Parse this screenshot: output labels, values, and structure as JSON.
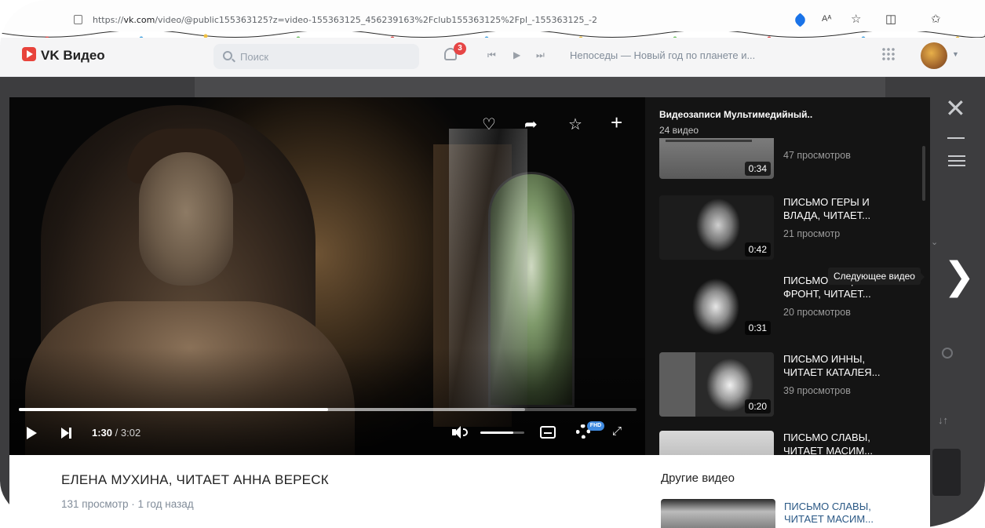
{
  "browser": {
    "url_prefix": "https://",
    "url_domain": "vk.com",
    "url_rest": "/video/@public155363125?z=video-155363125_456239163%2Fclub155363125%2Fpl_-155363125_-2",
    "read_aloud_icon_text": "Aᴬ"
  },
  "header": {
    "title": "VK Видео",
    "search_placeholder": "Поиск",
    "notification_count": "3",
    "now_playing": "Непоседы — Новый год по планете и..."
  },
  "player": {
    "time_current": "1:30",
    "time_total": " / 3:02",
    "progress": 0.5,
    "buffered": 0.82,
    "volume": 0.75,
    "quality_badge": "FHD"
  },
  "playlist": {
    "title": "Видеозаписи Мультимедийный..",
    "count": "24 видео",
    "items": [
      {
        "duration": "0:34",
        "title": "",
        "views": "47 просмотров"
      },
      {
        "duration": "0:42",
        "title": "ПИСЬМО ГЕРЫ И ВЛАДА, ЧИТАЕТ...",
        "views": "21 просмотр"
      },
      {
        "duration": "0:31",
        "title": "ПИСЬМО ОТЦА НА ФРОНТ, ЧИТАЕТ...",
        "views": "20 просмотров"
      },
      {
        "duration": "0:20",
        "title": "ПИСЬМО ИННЫ, ЧИТАЕТ КАТАЛЕЯ...",
        "views": "39 просмотров"
      },
      {
        "duration": "",
        "title": "ПИСЬМО СЛАВЫ, ЧИТАЕТ МАСИМ...",
        "views": ""
      }
    ]
  },
  "tooltip": {
    "next_video": "Следующее видео"
  },
  "video": {
    "title": "ЕЛЕНА МУХИНА, ЧИТАЕТ АННА ВЕРЕСК",
    "meta": "131 просмотр · 1 год назад"
  },
  "other_videos": {
    "heading": "Другие видео",
    "first_title": "ПИСЬМО СЛАВЫ, ЧИТАЕТ МАСИМ..."
  },
  "colors": {
    "accent": "#3f8ae0",
    "brand": "#e8433b",
    "badge": "#e64646",
    "link": "#2a5885"
  },
  "icons": [
    "lock-icon",
    "tag-icon",
    "favorites-icon",
    "reader-icon",
    "collections-icon",
    "close-icon",
    "minimize-icon",
    "list-icon",
    "next-video-icon",
    "heart-icon",
    "share-icon",
    "star-icon",
    "plus-icon",
    "play-icon",
    "next-track-icon",
    "volume-icon",
    "subtitles-icon",
    "gear-icon",
    "fullscreen-icon",
    "search-icon",
    "bell-icon",
    "apps-icon"
  ]
}
